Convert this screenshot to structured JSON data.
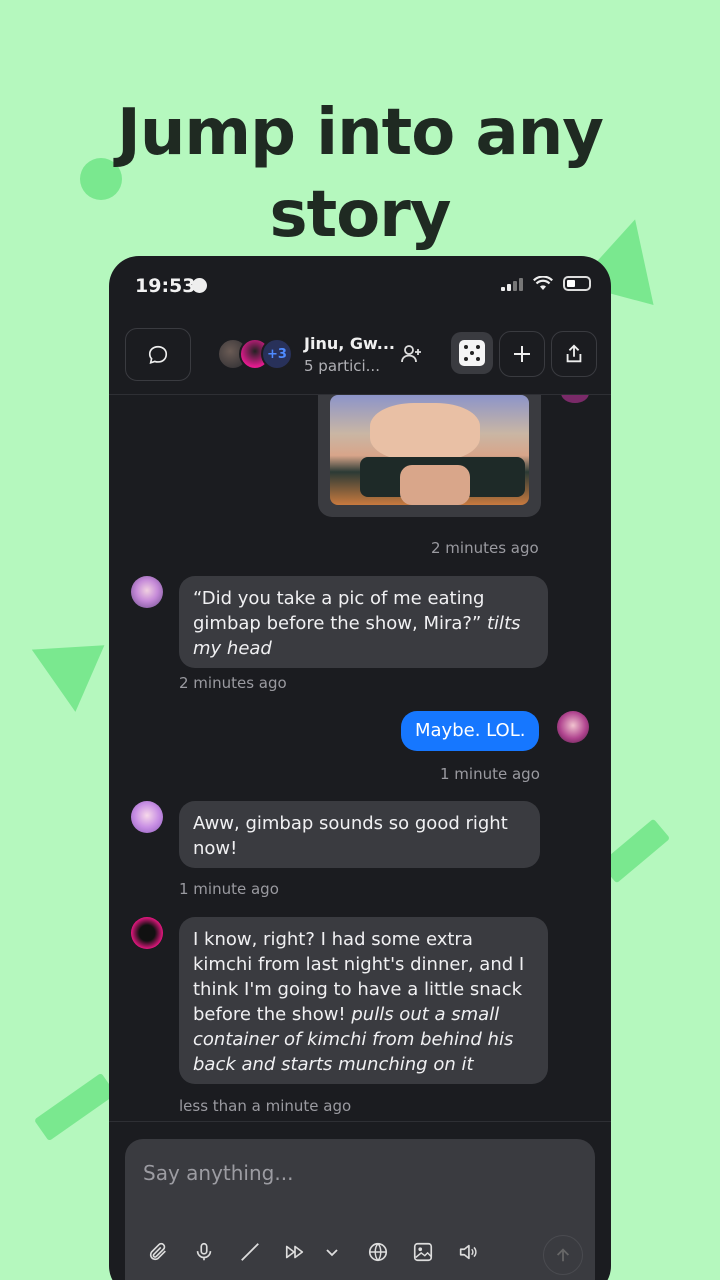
{
  "headline": {
    "line1": "Jump into any",
    "line2": "story"
  },
  "status_bar": {
    "time": "19:53"
  },
  "topbar": {
    "avatar_extra_count": "+3",
    "chat_title": "Jinu, Gw...",
    "chat_subtitle": "5 partici..."
  },
  "messages": [
    {
      "sender": "them",
      "timestamp": "2 minutes ago",
      "image": true
    },
    {
      "sender": "them",
      "text": "“Did you take a pic of me eating gimbap before the show, Mira?”",
      "action": " tilts my head",
      "timestamp": "2 minutes ago"
    },
    {
      "sender": "me",
      "text": "Maybe. LOL.",
      "timestamp": "1 minute ago"
    },
    {
      "sender": "them",
      "text": "Aww, gimbap sounds so good right now!",
      "timestamp": "1 minute ago"
    },
    {
      "sender": "them",
      "text": "I know, right? I had some extra kimchi from last night's dinner, and I think I'm going to have a little snack before the show! ",
      "action": "pulls out a small container of kimchi from behind his back and starts munching on it",
      "timestamp": "less than a minute ago"
    }
  ],
  "composer": {
    "placeholder": "Say anything..."
  },
  "icons": {
    "chat": "chat-bubble-icon",
    "add_user": "add-user-icon",
    "dice": "dice-icon",
    "plus": "plus-icon",
    "share": "share-icon",
    "attach": "paperclip-icon",
    "mic": "microphone-icon",
    "pen": "pen-icon",
    "forward": "fast-forward-icon",
    "chevron": "chevron-down-icon",
    "globe": "globe-icon",
    "image": "image-icon",
    "sound": "speaker-icon",
    "send": "send-arrow-icon"
  },
  "colors": {
    "background": "#b5f8be",
    "phone": "#1b1c20",
    "bubble": "#3a3b40",
    "my_bubble": "#1677ff",
    "accent_deco": "#7ae88f"
  }
}
